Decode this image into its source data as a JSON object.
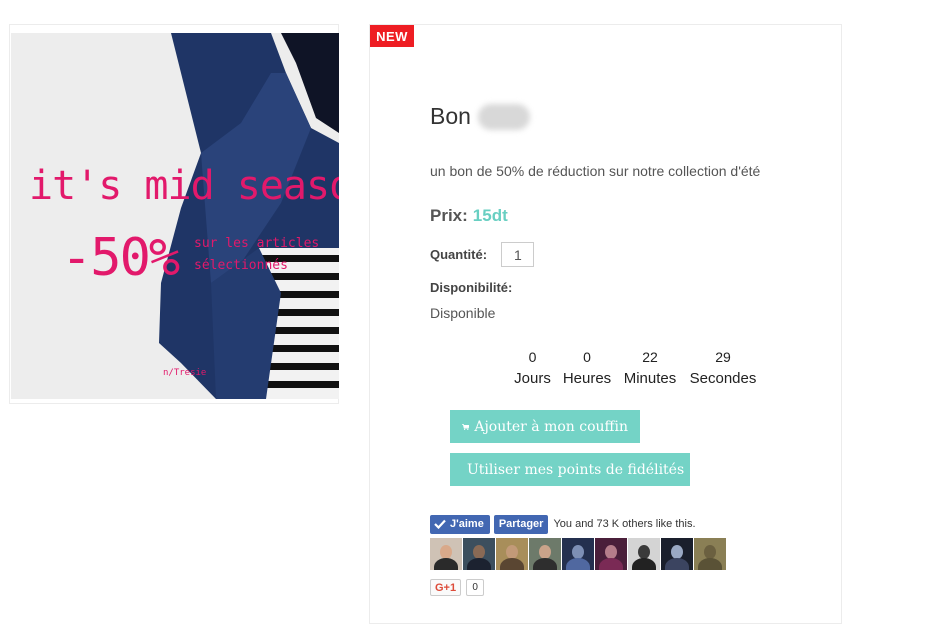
{
  "badge": {
    "new_label": "NEW"
  },
  "promo": {
    "headline": "it's mid season",
    "discount": "-50%",
    "sub_line1": "sur les articles",
    "sub_line2": "sélectionnés",
    "small": "n/Tresie"
  },
  "product": {
    "title": "Bon",
    "description": "un bon de 50% de réduction sur notre collection d'été",
    "price_label": "Prix:",
    "price_value": "15dt",
    "qty_label": "Quantité:",
    "qty_value": "1",
    "availability_label": "Disponibilité:",
    "availability_value": "Disponible"
  },
  "countdown": [
    {
      "value": "0",
      "label": "Jours"
    },
    {
      "value": "0",
      "label": "Heures"
    },
    {
      "value": "22",
      "label": "Minutes"
    },
    {
      "value": "29",
      "label": "Secondes"
    }
  ],
  "buttons": {
    "add_to_cart": "Ajouter à mon couffin",
    "use_points": "Utiliser mes points de fidélités"
  },
  "social": {
    "like_label": "J'aime",
    "share_label": "Partager",
    "social_text": "You and 73 K others like this.",
    "gplus_label": "G+1",
    "gplus_count": "0"
  },
  "colors": {
    "accent": "#74d3c6",
    "price": "#68cfc2",
    "badge": "#ee1d23",
    "promo_pink": "#e2196b",
    "facebook": "#4267b2"
  },
  "icons": [
    "cart-icon",
    "checkmark-icon"
  ]
}
